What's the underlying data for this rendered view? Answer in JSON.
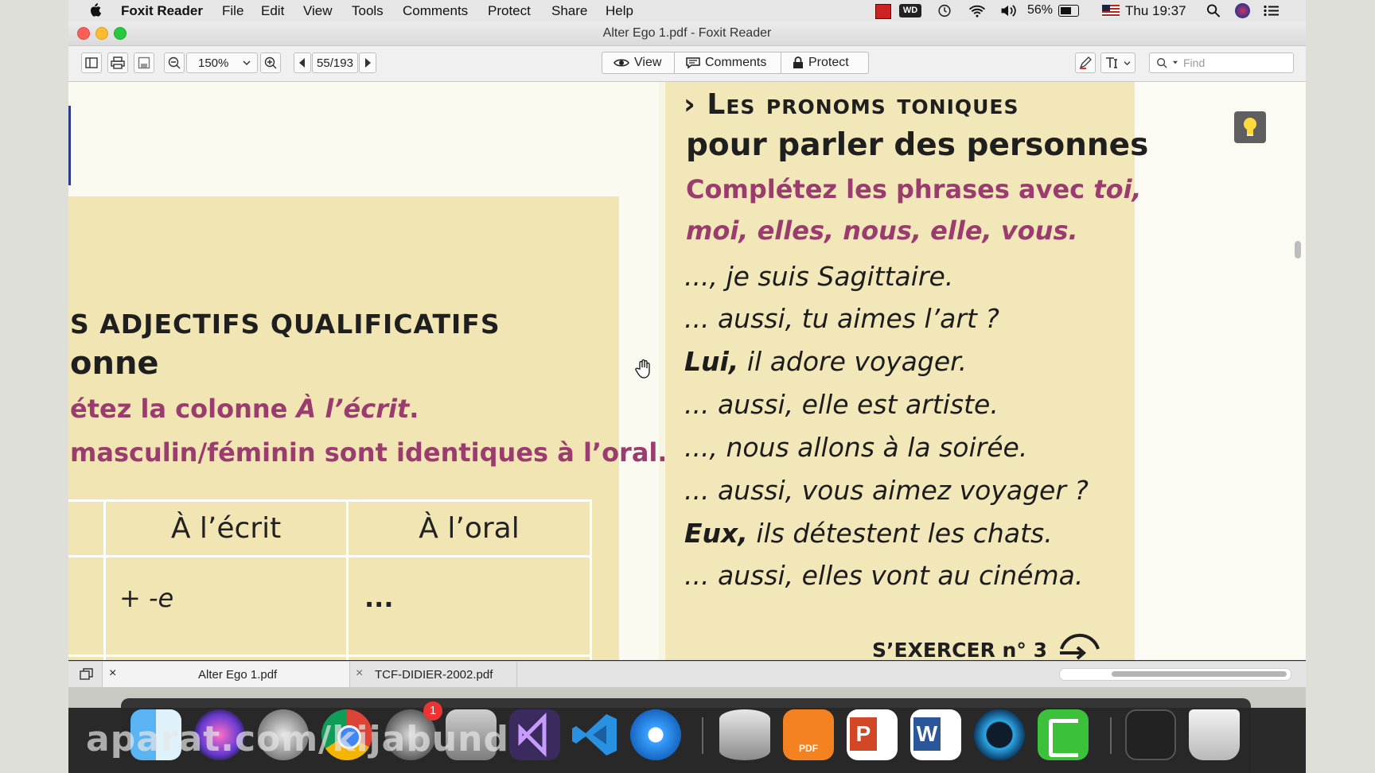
{
  "menubar": {
    "app_name": "Foxit Reader",
    "items": [
      "File",
      "Edit",
      "View",
      "Tools",
      "Comments",
      "Protect",
      "Share",
      "Help"
    ],
    "battery": "56%",
    "clock": "Thu 19:37"
  },
  "window": {
    "title": "Alter Ego 1.pdf - Foxit Reader"
  },
  "toolbar": {
    "zoom": "150%",
    "page": "55/193",
    "view_label": "View",
    "comments_label": "Comments",
    "protect_label": "Protect",
    "find_placeholder": "Find"
  },
  "left_page": {
    "heading1": "S ADJECTIFS QUALIFICATIFS",
    "heading2": "onne",
    "instr1_plain": "étez la colonne ",
    "instr1_italic": "À l’écrit",
    "instr1_end": ".",
    "instr2": "masculin/féminin sont identiques à l’oral.",
    "table": {
      "headers": [
        "À l’écrit",
        "À l’oral"
      ],
      "rows": [
        [
          "+ -e",
          "..."
        ]
      ]
    }
  },
  "right_page": {
    "title_caps": "Les pronoms toniques",
    "title_sub": "pour parler des personnes",
    "instr_plain": "Complétez les phrases avec ",
    "instr_italic1": "toi,",
    "instr_italic2": "moi, elles, nous, elle, vous.",
    "exercises": [
      {
        "bold": "",
        "rest": "..., je suis Sagittaire."
      },
      {
        "bold": "",
        "rest": "... aussi, tu aimes l’art ?"
      },
      {
        "bold": "Lui,",
        "rest": " il adore voyager."
      },
      {
        "bold": "",
        "rest": "... aussi, elle est artiste."
      },
      {
        "bold": "",
        "rest": "..., nous allons à la soirée."
      },
      {
        "bold": "",
        "rest": "... aussi, vous aimez voyager ?"
      },
      {
        "bold": "Eux,",
        "rest": " ils détestent les chats."
      },
      {
        "bold": "",
        "rest": "... aussi, elles vont au cinéma."
      }
    ],
    "sexercer": "S’EXERCER n° 3"
  },
  "tabs": [
    {
      "label": "Alter Ego 1.pdf",
      "active": true
    },
    {
      "label": "TCF-DIDIER-2002.pdf",
      "active": false
    }
  ],
  "dock": {
    "badge": "1"
  },
  "watermark": "aparat.com/kijabund"
}
